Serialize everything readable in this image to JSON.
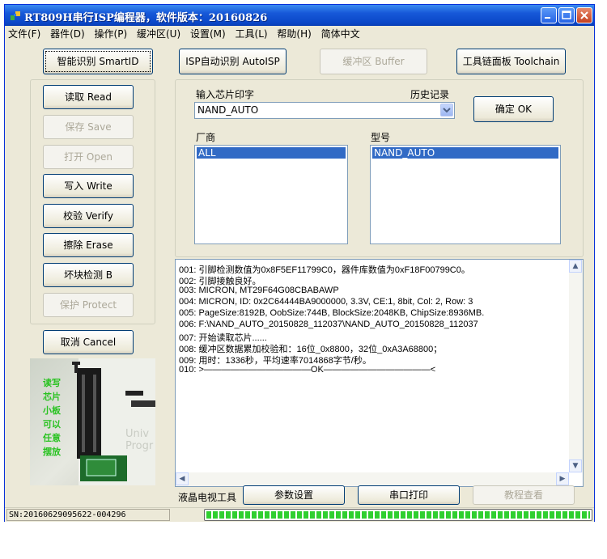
{
  "window": {
    "title": "RT809H串行ISP编程器，软件版本：20160826",
    "controls": [
      "minimize-icon",
      "maximize-icon",
      "close-icon"
    ]
  },
  "menu": [
    "文件(F)",
    "器件(D)",
    "操作(P)",
    "缓冲区(U)",
    "设置(M)",
    "工具(L)",
    "帮助(H)",
    "简体中文"
  ],
  "toolbar": {
    "smartid": "智能识别 SmartID",
    "isp_auto": "ISP自动识别 AutoISP",
    "buffer": "缓冲区 Buffer",
    "toolchain": "工具链面板 Toolchain"
  },
  "actions": {
    "read": "读取 Read",
    "save": "保存 Save",
    "open": "打开 Open",
    "write": "写入 Write",
    "verify": "校验 Verify",
    "erase": "擦除 Erase",
    "badblock": "坏块检测 B",
    "protect": "保护 Protect",
    "cancel": "取消 Cancel"
  },
  "chip": {
    "input_label": "输入芯片印字",
    "history_label": "历史记录",
    "input_value": "NAND_AUTO",
    "ok": "确定 OK",
    "vendor_label": "厂商",
    "model_label": "型号",
    "vendors": [
      "ALL"
    ],
    "models": [
      "NAND_AUTO"
    ]
  },
  "log": [
    "001: 引脚检测数值为0x8F5EF11799C0，器件库数值为0xF18F00799C0。",
    "002: 引脚接触良好。",
    "003: MICRON, MT29F64G08CBABAWP",
    "004: MICRON, ID: 0x2C64444BA9000000, 3.3V, CE:1, 8bit, Col: 2, Row: 3",
    "005: PageSize:8192B, OobSize:744B, BlockSize:2048KB, ChipSize:8936MB.",
    "006: F:\\NAND_AUTO_20150828_112037\\NAND_AUTO_20150828_112037",
    "007: 开始读取芯片......",
    "008: 缓冲区数据累加校验和：16位_0x8800，32位_0xA3A68800；",
    "009: 用时：1336秒，平均速率7014868字节/秒。",
    "010: >————————————OK————————————<"
  ],
  "picture": {
    "caption_lines": [
      "读写",
      "芯片",
      "小板",
      "可以",
      "任意",
      "摆放"
    ],
    "brand_lines": [
      "Univ",
      "Progr"
    ]
  },
  "bottom": {
    "lcd_tools": "液晶电视工具",
    "params": "参数设置",
    "serial_print": "串口打印",
    "tutorial": "教程查看"
  },
  "status": {
    "serial": "SN:20160629095622-004296",
    "progress": 1.0
  },
  "colors": {
    "title_blue": "#0b47c8",
    "selection": "#316ac5",
    "progress_green": "#2fcf2f",
    "picture_text": "#27c21f"
  }
}
